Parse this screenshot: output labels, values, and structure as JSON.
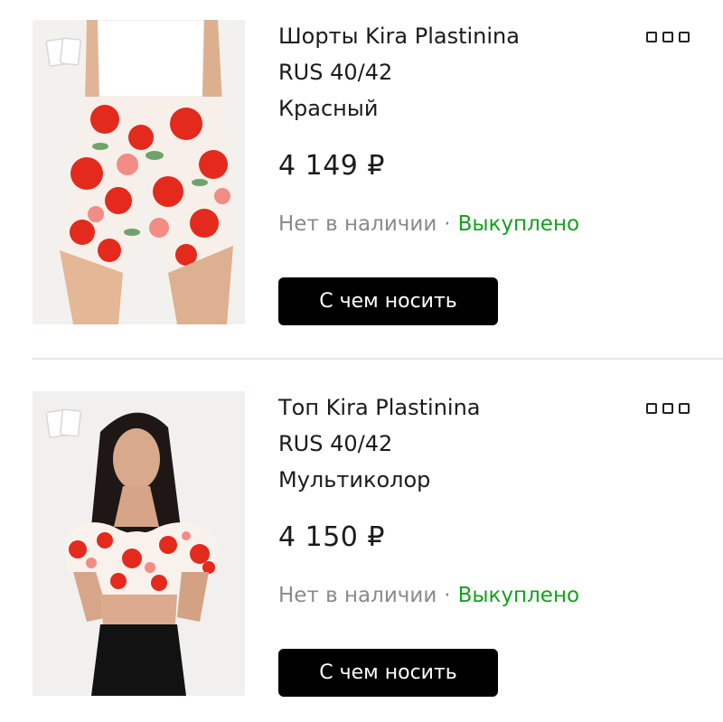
{
  "items": [
    {
      "title": "Шорты Kira Plastinina",
      "size": "RUS 40/42",
      "color": "Красный",
      "price": "4 149 ₽",
      "stock_status": "Нет в наличии",
      "separator": "·",
      "purchase_status": "Выкуплено",
      "button_label": "С чем носить",
      "menu_icon": "more-options-icon",
      "compare_icon": "compare-cards-icon"
    },
    {
      "title": "Топ Kira Plastinina",
      "size": "RUS 40/42",
      "color": "Мультиколор",
      "price": "4 150 ₽",
      "stock_status": "Нет в наличии",
      "separator": "·",
      "purchase_status": "Выкуплено",
      "button_label": "С чем носить",
      "menu_icon": "more-options-icon",
      "compare_icon": "compare-cards-icon"
    }
  ],
  "colors": {
    "accent_green": "#14a01e",
    "muted_text": "#8a8a8a",
    "button_bg": "#000000"
  }
}
